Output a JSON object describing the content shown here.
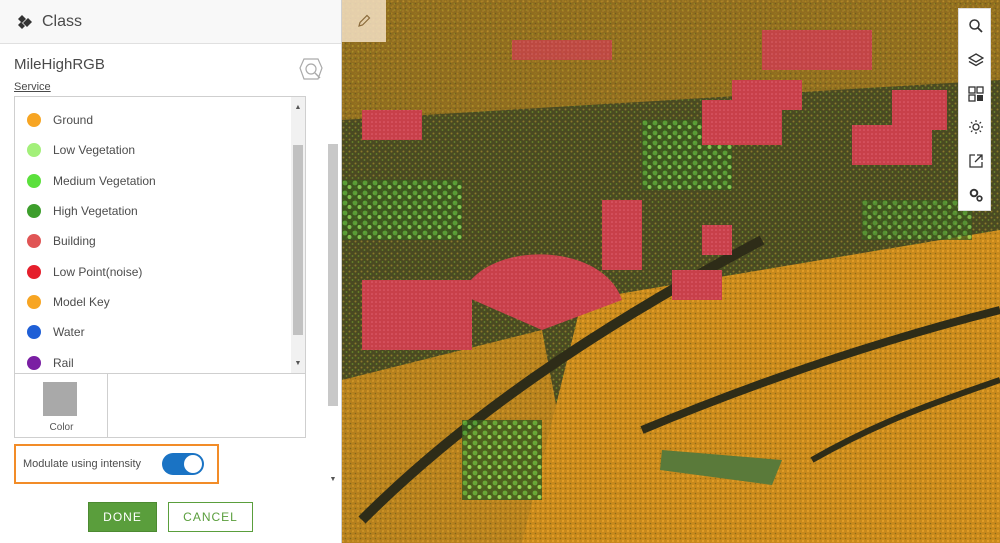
{
  "panel": {
    "title": "Class",
    "layer_name": "MileHighRGB",
    "service_link": "Service"
  },
  "classes": [
    {
      "label": "Ground",
      "color": "#f7a523"
    },
    {
      "label": "Low Vegetation",
      "color": "#a3f07a"
    },
    {
      "label": "Medium Vegetation",
      "color": "#5be03c"
    },
    {
      "label": "High Vegetation",
      "color": "#3d9e2c"
    },
    {
      "label": "Building",
      "color": "#e05555"
    },
    {
      "label": "Low Point(noise)",
      "color": "#e51f2c"
    },
    {
      "label": "Model Key",
      "color": "#f7a523"
    },
    {
      "label": "Water",
      "color": "#1f5fd6"
    },
    {
      "label": "Rail",
      "color": "#7a1fa3"
    }
  ],
  "color_editor": {
    "label": "Color",
    "swatch_color": "#a9a9a9"
  },
  "modulate": {
    "label": "Modulate using intensity",
    "enabled": true
  },
  "buttons": {
    "done": "DONE",
    "cancel": "CANCEL"
  },
  "toolbar_icons": [
    "search-icon",
    "layers-icon",
    "basemap-gallery-icon",
    "daylight-icon",
    "share-icon",
    "settings-icon"
  ],
  "colors": {
    "accent_green": "#5a9e3c",
    "toggle_blue": "#1a73c4",
    "highlight_orange": "#f28c28"
  }
}
